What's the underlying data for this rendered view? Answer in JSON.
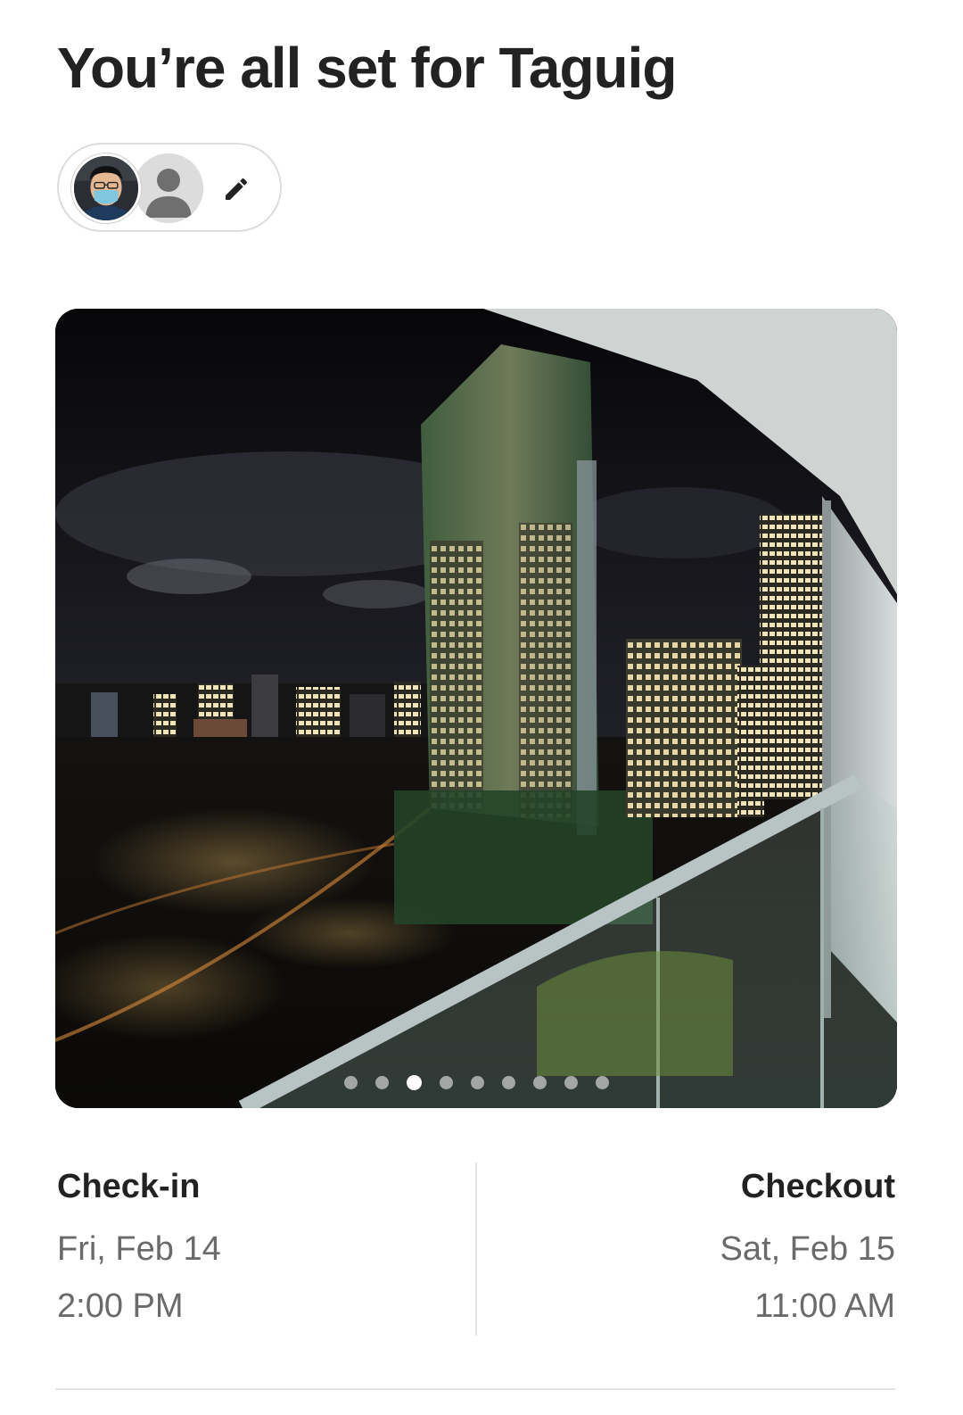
{
  "header": {
    "title": "You’re all set for Taguig"
  },
  "guests": {
    "host_avatar_icon": "user-photo-avatar",
    "guest_avatar_icon": "default-person-avatar",
    "edit_icon": "pencil-icon"
  },
  "listing_photo": {
    "description_icon": "night-city-balcony-photo",
    "carousel_total": 9,
    "carousel_active_index": 2
  },
  "checkin": {
    "label": "Check-in",
    "date": "Fri, Feb 14",
    "time": "2:00 PM"
  },
  "checkout": {
    "label": "Checkout",
    "date": "Sat, Feb 15",
    "time": "11:00 AM"
  },
  "colors": {
    "text_primary": "#222222",
    "text_secondary": "#6a6a6a",
    "border": "#dddddd"
  }
}
